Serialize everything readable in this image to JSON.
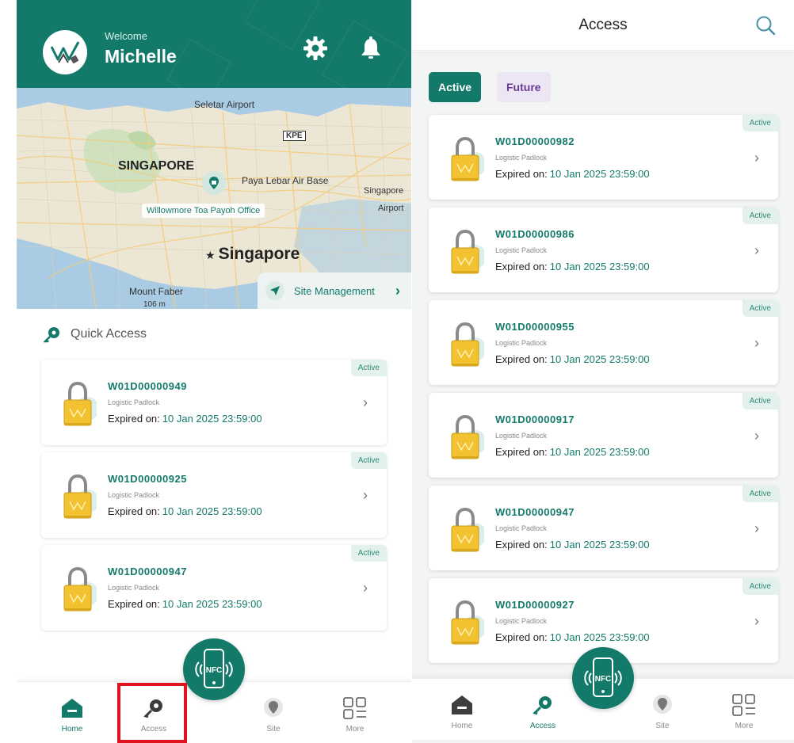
{
  "home": {
    "welcome": "Welcome",
    "user_name": "Michelle",
    "map": {
      "places": {
        "seletar": "Seletar Airport",
        "kpe": "KPE",
        "singapore_region": "SINGAPORE",
        "paya_lebar": "Paya Lebar Air Base",
        "singapore_airport_1": "Singapore",
        "singapore_airport_2": "Airport",
        "singapore_city": "Singapore",
        "mount_faber": "Mount Faber",
        "mount_faber_height": "106 m"
      },
      "office_label": "Willowmore Toa Payoh Office",
      "site_management": "Site Management"
    },
    "quick_access_title": "Quick Access",
    "cards": [
      {
        "code": "W01D00000949",
        "type": "Logistic Padlock",
        "expired_label": "Expired on:",
        "expiry": "10 Jan 2025 23:59:00",
        "status": "Active"
      },
      {
        "code": "W01D00000925",
        "type": "Logistic Padlock",
        "expired_label": "Expired on:",
        "expiry": "10 Jan 2025 23:59:00",
        "status": "Active"
      },
      {
        "code": "W01D00000947",
        "type": "Logistic Padlock",
        "expired_label": "Expired on:",
        "expiry": "10 Jan 2025 23:59:00",
        "status": "Active"
      }
    ]
  },
  "access": {
    "title": "Access",
    "tabs": {
      "active": "Active",
      "future": "Future"
    },
    "cards": [
      {
        "code": "W01D00000982",
        "type": "Logistic Padlock",
        "expired_label": "Expired on:",
        "expiry": "10 Jan 2025 23:59:00",
        "status": "Active"
      },
      {
        "code": "W01D00000986",
        "type": "Logistic Padlock",
        "expired_label": "Expired on:",
        "expiry": "10 Jan 2025 23:59:00",
        "status": "Active"
      },
      {
        "code": "W01D00000955",
        "type": "Logistic Padlock",
        "expired_label": "Expired on:",
        "expiry": "10 Jan 2025 23:59:00",
        "status": "Active"
      },
      {
        "code": "W01D00000917",
        "type": "Logistic Padlock",
        "expired_label": "Expired on:",
        "expiry": "10 Jan 2025 23:59:00",
        "status": "Active"
      },
      {
        "code": "W01D00000947",
        "type": "Logistic Padlock",
        "expired_label": "Expired on:",
        "expiry": "10 Jan 2025 23:59:00",
        "status": "Active"
      },
      {
        "code": "W01D00000927",
        "type": "Logistic Padlock",
        "expired_label": "Expired on:",
        "expiry": "10 Jan 2025 23:59:00",
        "status": "Active"
      }
    ]
  },
  "nav": {
    "home": "Home",
    "access": "Access",
    "site": "Site",
    "more": "More",
    "nfc": "NFC"
  },
  "icons": {
    "logo": "willowmore-logo",
    "settings": "gear-icon",
    "notification": "bell-icon",
    "search": "search-icon",
    "lock": "padlock-icon",
    "chevron": "chevron-right-icon",
    "key": "key-icon",
    "location": "location-pin-icon",
    "home": "home-icon",
    "grid": "grid-icon",
    "nfc": "nfc-phone-icon",
    "send": "navigation-arrow-icon"
  },
  "colors": {
    "brand_green": "#137a6a",
    "badge_bg": "#e3f1ec",
    "future_tab_bg": "#ece5f3",
    "future_tab_text": "#6a3a95",
    "lock_yellow": "#f2c230",
    "highlight_red": "#e0141e"
  }
}
